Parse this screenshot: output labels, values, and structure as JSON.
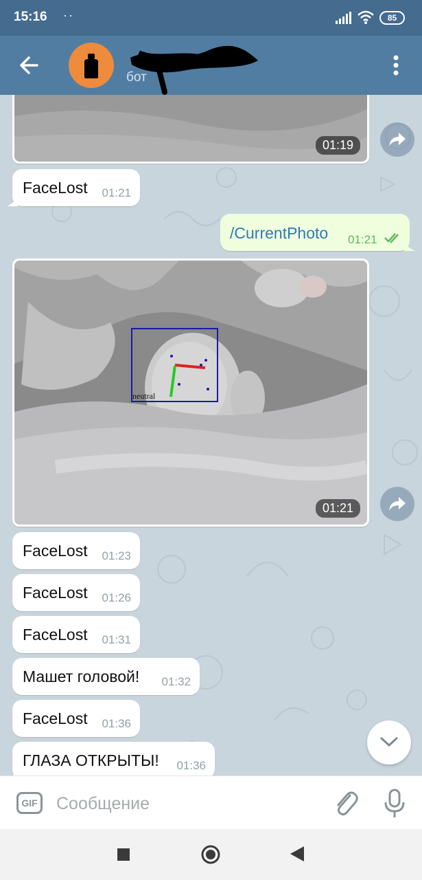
{
  "status_bar": {
    "time": "15:16",
    "dots": "··",
    "battery": "85"
  },
  "header": {
    "subtitle": "бот"
  },
  "photos": [
    {
      "time": "01:19"
    },
    {
      "time": "01:21",
      "overlay_label": "neutral"
    }
  ],
  "outgoing": {
    "text": "/CurrentPhoto",
    "time": "01:21"
  },
  "messages": [
    {
      "text": "FaceLost",
      "time": "01:21"
    },
    {
      "text": "FaceLost",
      "time": "01:23"
    },
    {
      "text": "FaceLost",
      "time": "01:26"
    },
    {
      "text": "FaceLost",
      "time": "01:31"
    },
    {
      "text": "Машет головой!",
      "time": "01:32"
    },
    {
      "text": "FaceLost",
      "time": "01:36"
    },
    {
      "text": "ГЛАЗА ОТКРЫТЫ!",
      "time": "01:36"
    }
  ],
  "input": {
    "gif_label": "GIF",
    "placeholder": "Сообщение"
  },
  "colors": {
    "header": "#517da2",
    "status_bar": "#456b8f",
    "avatar": "#ef8b3c",
    "outgoing_bubble": "#efffde",
    "chat_bg": "#c9d5dd"
  },
  "icons": {
    "back": "arrow-left-icon",
    "menu": "more-vertical-icon",
    "share": "forward-icon",
    "scroll": "chevron-down-icon",
    "attach": "paperclip-icon",
    "mic": "microphone-icon"
  }
}
